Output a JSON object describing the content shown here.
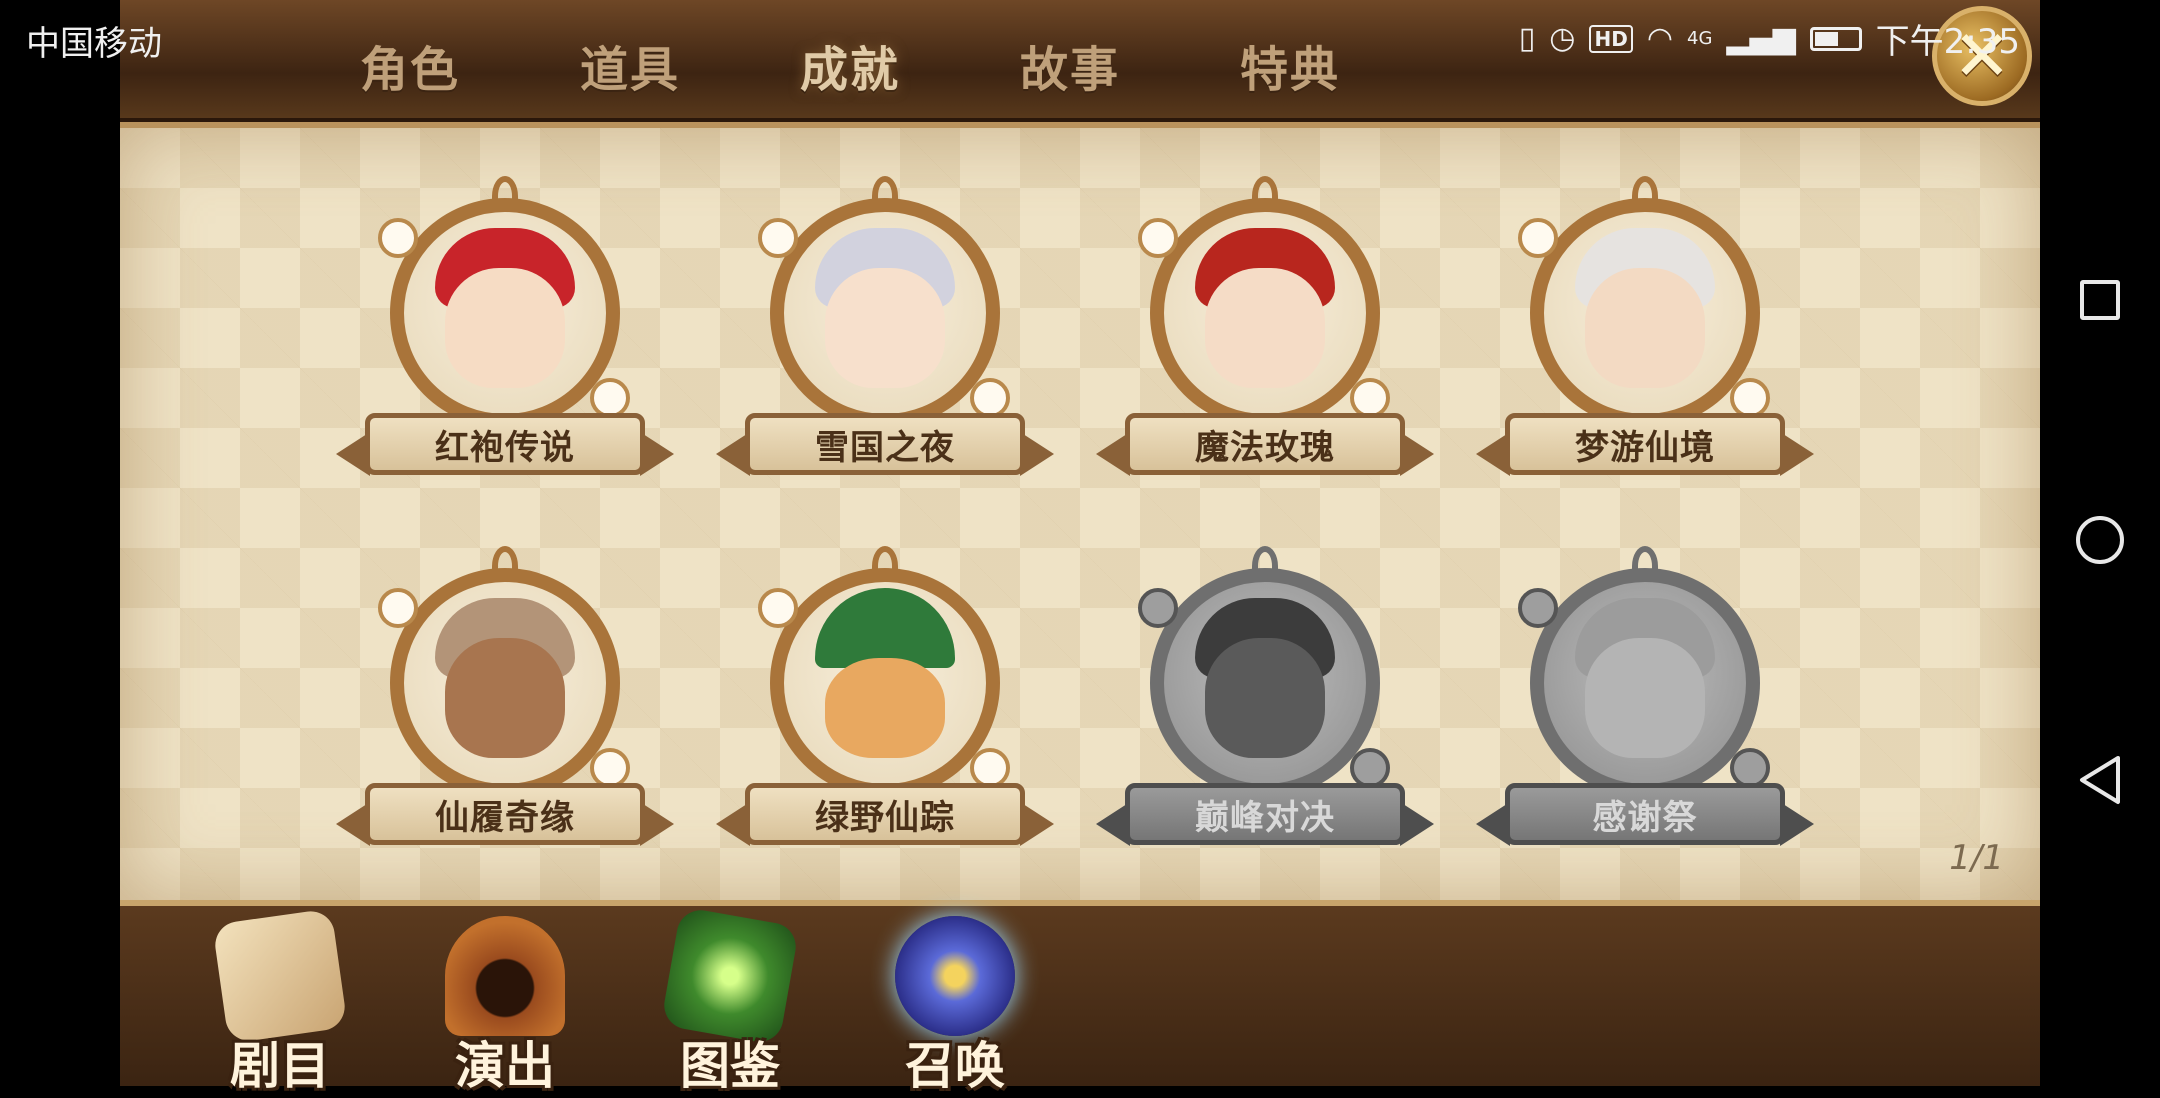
{
  "status_bar": {
    "carrier": "中国移动",
    "time": "下午2:35",
    "icons": [
      "vibrate-icon",
      "alarm-icon",
      "hd-icon",
      "wifi-icon",
      "4g-signal-icon",
      "battery-icon"
    ],
    "hd_label": "HD",
    "network_label": "4G",
    "battery_level": 0.55
  },
  "tabs": [
    {
      "label": "角色",
      "active": false
    },
    {
      "label": "道具",
      "active": false
    },
    {
      "label": "成就",
      "active": true
    },
    {
      "label": "故事",
      "active": false
    },
    {
      "label": "特典",
      "active": false
    }
  ],
  "close_icon": "close-icon",
  "cards": [
    {
      "label": "红袍传说",
      "locked": false
    },
    {
      "label": "雪国之夜",
      "locked": false
    },
    {
      "label": "魔法玫瑰",
      "locked": false
    },
    {
      "label": "梦游仙境",
      "locked": false
    },
    {
      "label": "仙履奇缘",
      "locked": false
    },
    {
      "label": "绿野仙踪",
      "locked": false
    },
    {
      "label": "巅峰对决",
      "locked": true
    },
    {
      "label": "感谢祭",
      "locked": true
    }
  ],
  "page_indicator": "1/1",
  "bottom_nav": [
    {
      "label": "剧目",
      "icon": "scroll-quill-icon"
    },
    {
      "label": "演出",
      "icon": "stage-icon"
    },
    {
      "label": "图鉴",
      "icon": "book-icon"
    },
    {
      "label": "召唤",
      "icon": "summon-orb-icon"
    }
  ],
  "system_nav": [
    "recents-icon",
    "home-icon",
    "back-icon"
  ],
  "colors": {
    "frame_brown": "#3d2412",
    "gold_trim": "#c7a46b",
    "panel_cream": "#efe3c6",
    "locked_gray": "#8e8e8e"
  }
}
